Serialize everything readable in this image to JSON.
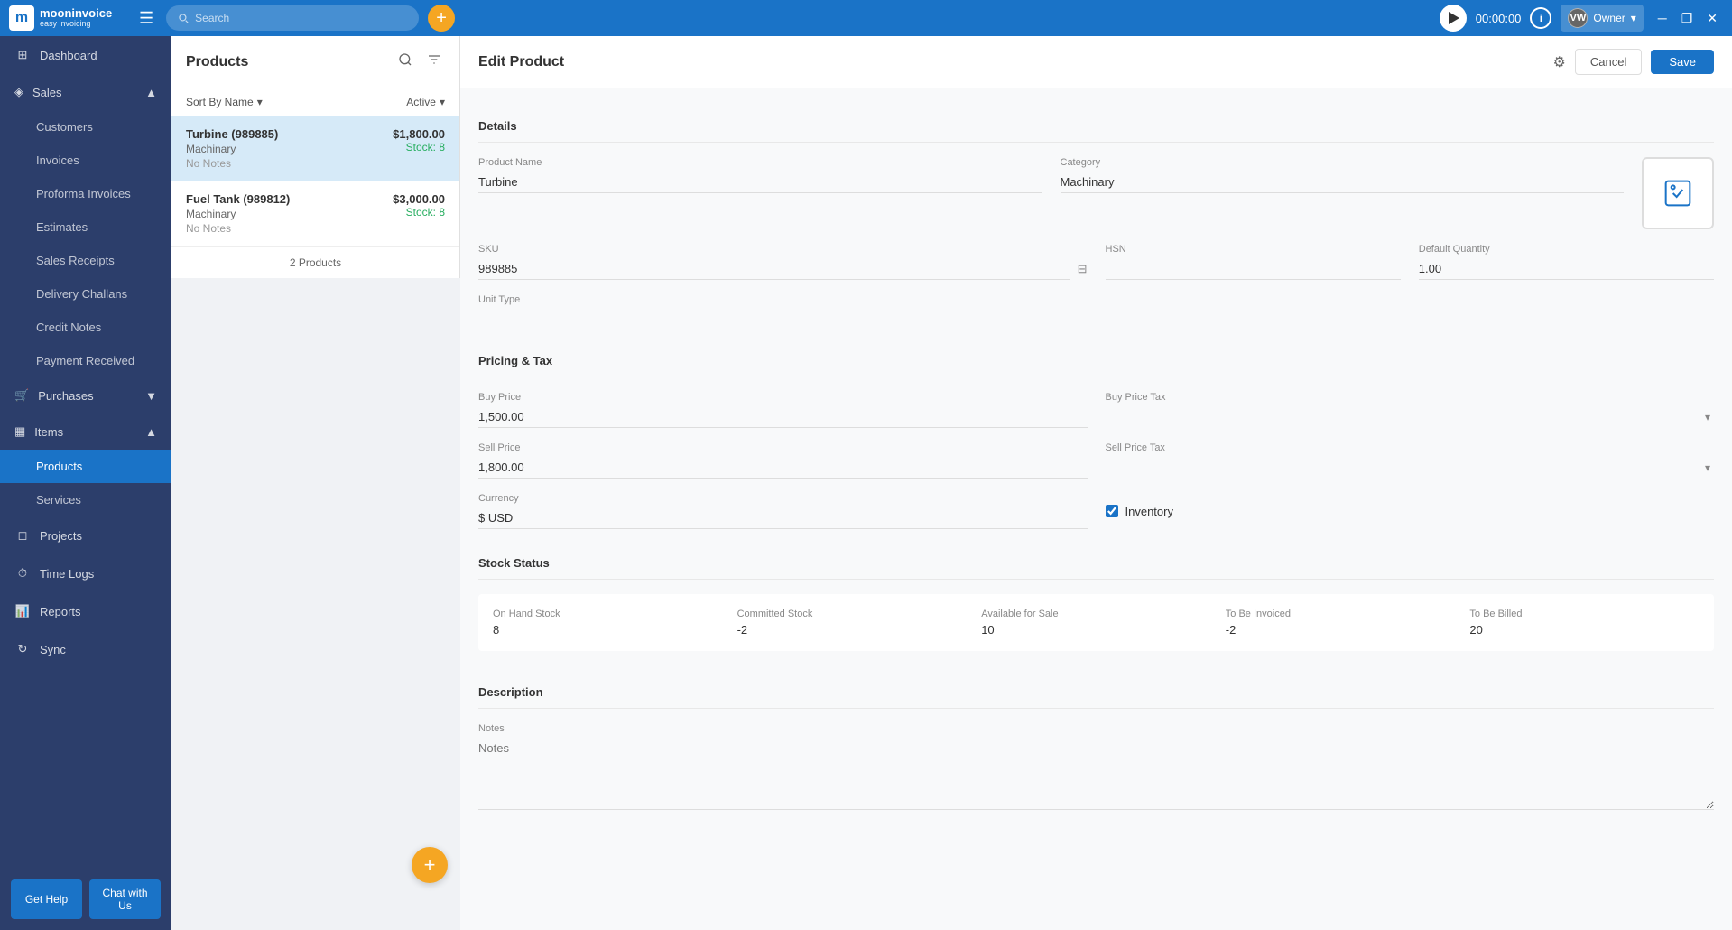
{
  "app": {
    "name": "mooninvoice",
    "tagline": "easy invoicing",
    "logo_letter": "m"
  },
  "topbar": {
    "search_placeholder": "Search",
    "add_btn_label": "+",
    "timer": "00:00:00",
    "owner_label": "Owner",
    "owner_initials": "VW"
  },
  "sidebar": {
    "dashboard": "Dashboard",
    "sales": "Sales",
    "sales_sub": [
      "Customers",
      "Invoices",
      "Proforma Invoices",
      "Estimates",
      "Sales Receipts",
      "Delivery Challans",
      "Credit Notes",
      "Payment Received"
    ],
    "purchases": "Purchases",
    "items": "Items",
    "items_sub": [
      "Products",
      "Services"
    ],
    "products": "Products",
    "services": "Services",
    "projects": "Projects",
    "time_logs": "Time Logs",
    "reports": "Reports",
    "sync": "Sync",
    "get_help": "Get Help",
    "chat_with_us": "Chat with Us"
  },
  "products_panel": {
    "title": "Products",
    "sort_label": "Sort By Name",
    "filter_label": "Active",
    "footer": "2 Products",
    "products": [
      {
        "name": "Turbine (989885)",
        "category": "Machinary",
        "price": "$1,800.00",
        "stock": "Stock: 8",
        "notes": "No Notes",
        "selected": true
      },
      {
        "name": "Fuel Tank (989812)",
        "category": "Machinary",
        "price": "$3,000.00",
        "stock": "Stock: 8",
        "notes": "No Notes",
        "selected": false
      }
    ]
  },
  "edit_product": {
    "title": "Edit Product",
    "cancel_label": "Cancel",
    "save_label": "Save",
    "sections": {
      "details": "Details",
      "pricing_tax": "Pricing & Tax",
      "stock_status": "Stock Status",
      "description": "Description"
    },
    "fields": {
      "product_name_label": "Product Name",
      "product_name_value": "Turbine",
      "category_label": "Category",
      "category_value": "Machinary",
      "sku_label": "SKU",
      "sku_value": "989885",
      "hsn_label": "HSN",
      "hsn_value": "",
      "default_quantity_label": "Default Quantity",
      "default_quantity_value": "1.00",
      "unit_type_label": "Unit Type",
      "unit_type_value": "",
      "buy_price_label": "Buy Price",
      "buy_price_value": "1,500.00",
      "buy_price_tax_label": "Buy Price Tax",
      "buy_price_tax_value": "",
      "sell_price_label": "Sell Price",
      "sell_price_value": "1,800.00",
      "sell_price_tax_label": "Sell Price Tax",
      "sell_price_tax_value": "",
      "currency_label": "Currency",
      "currency_value": "$ USD",
      "inventory_label": "Inventory",
      "inventory_checked": true,
      "stock": {
        "on_hand_label": "On Hand Stock",
        "on_hand_value": "8",
        "committed_label": "Committed Stock",
        "committed_value": "-2",
        "available_label": "Available for Sale",
        "available_value": "10",
        "to_be_invoiced_label": "To Be Invoiced",
        "to_be_invoiced_value": "-2",
        "to_be_billed_label": "To Be Billed",
        "to_be_billed_value": "20"
      },
      "notes_label": "Notes",
      "notes_value": ""
    }
  }
}
